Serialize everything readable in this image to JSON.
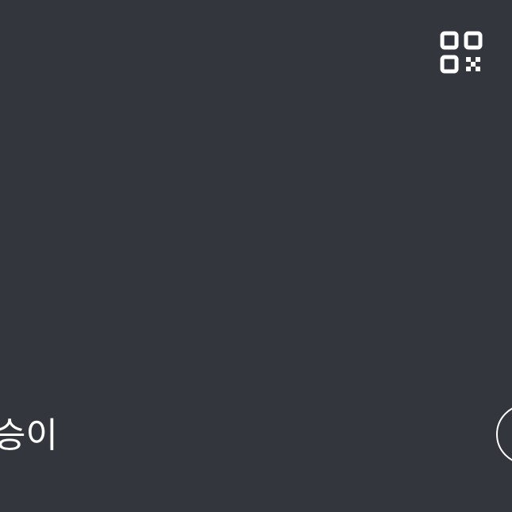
{
  "header": {
    "qr_icon": "qr-code-icon",
    "qr_color": "#ffffff"
  },
  "profile": {
    "name": "승이"
  },
  "actions": {
    "circle_icon": "circle-outline-icon",
    "circle_color": "#ffffff"
  },
  "theme": {
    "background": "#33363d",
    "foreground": "#ffffff"
  }
}
